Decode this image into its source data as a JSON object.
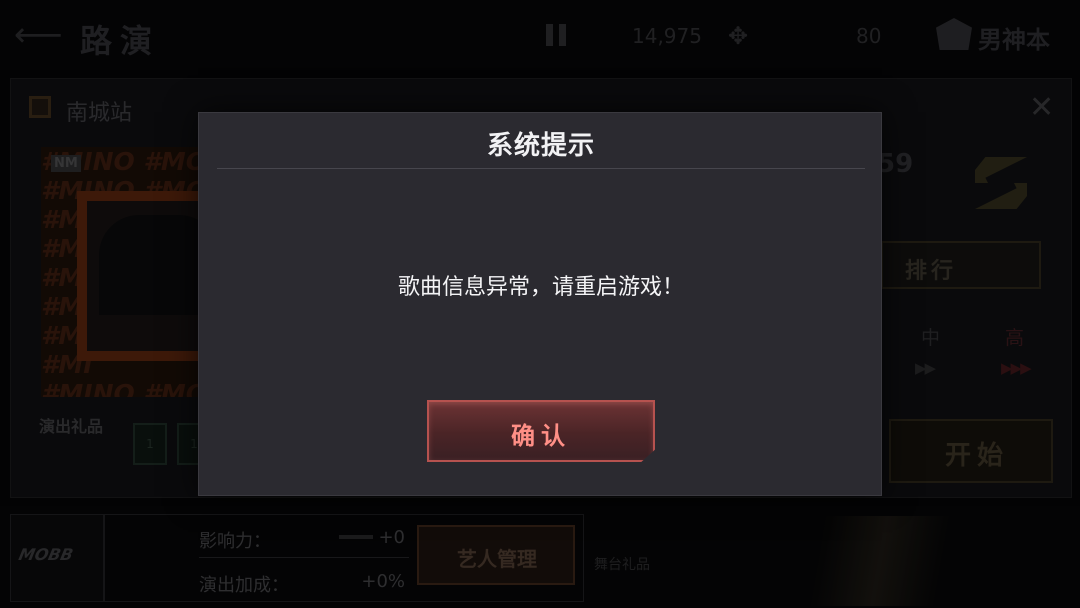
{
  "topbar": {
    "title": "路演",
    "currency_value": "14,975",
    "energy_value": "80",
    "shop_label": "男神本"
  },
  "stage": {
    "name": "南城站",
    "album_badge": "NM",
    "album_pattern": "#MINO #MOBB\n#MINO #MOBB\n#MI\n#MI\n#MI\n#MI\n#MI\n#MI\n#MINO #MOBB\n#MINO #MOBB",
    "gifts_label": "演出礼品",
    "gift_slots": [
      "1",
      "1"
    ],
    "score_fragment": "59",
    "rank_label": "排行",
    "difficulty_mid": "中",
    "difficulty_high": "高",
    "difficulty_arrows_mid": "▶▶",
    "difficulty_arrows_high": "▶▶▶",
    "start_label": "开始"
  },
  "bottom": {
    "artist_logo": "MOBB",
    "influence_label": "影响力：",
    "influence_value": "+0",
    "bonus_label": "演出加成：",
    "bonus_value": "+0%",
    "manage_label": "艺人管理",
    "gift_hint": "舞台礼品"
  },
  "dialog": {
    "title": "系统提示",
    "message": "歌曲信息异常，请重启游戏！",
    "confirm_label": "确认"
  },
  "colors": {
    "dialog_bg": "#2b2a30",
    "confirm_text": "#ff8f86",
    "confirm_border": "#b6524f"
  }
}
